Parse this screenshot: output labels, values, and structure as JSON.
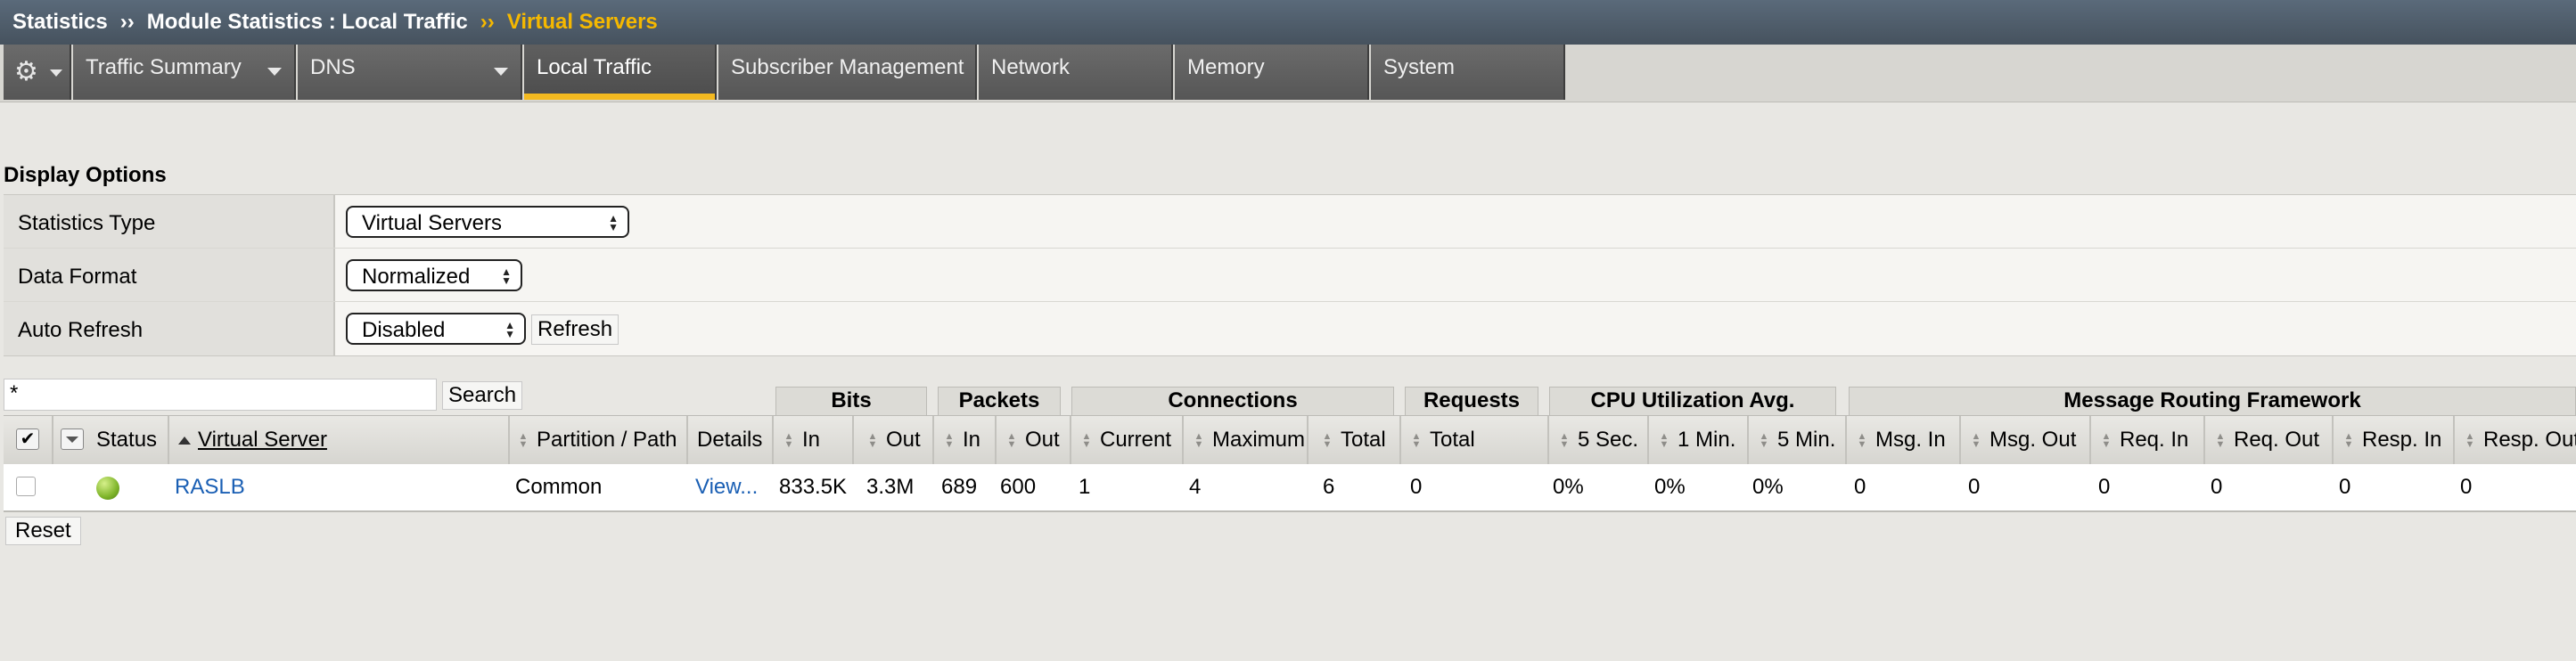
{
  "breadcrumb": {
    "root": "Statistics",
    "sep1": "››",
    "parent": "Module Statistics : Local Traffic",
    "sep2": "››",
    "current": "Virtual Servers"
  },
  "tabs": [
    {
      "label": "Traffic Summary",
      "has_menu": true
    },
    {
      "label": "DNS",
      "has_menu": true
    },
    {
      "label": "Local Traffic",
      "active": true
    },
    {
      "label": "Subscriber Management"
    },
    {
      "label": "Network"
    },
    {
      "label": "Memory"
    },
    {
      "label": "System"
    }
  ],
  "display_options": {
    "title": "Display Options",
    "statistics_type": {
      "label": "Statistics Type",
      "value": "Virtual Servers"
    },
    "data_format": {
      "label": "Data Format",
      "value": "Normalized"
    },
    "auto_refresh": {
      "label": "Auto Refresh",
      "value": "Disabled",
      "button": "Refresh"
    }
  },
  "filter": {
    "value": "*",
    "button": "Search"
  },
  "groups": {
    "bits": "Bits",
    "packets": "Packets",
    "connections": "Connections",
    "requests": "Requests",
    "cpu": "CPU Utilization Avg.",
    "mrf": "Message Routing Framework"
  },
  "columns": {
    "status": "Status",
    "virtual_server": "Virtual Server",
    "partition": "Partition / Path",
    "details": "Details",
    "bits_in": "In",
    "bits_out": "Out",
    "pkts_in": "In",
    "pkts_out": "Out",
    "conn_current": "Current",
    "conn_max": "Maximum",
    "conn_total": "Total",
    "req_total": "Total",
    "cpu_5s": "5 Sec.",
    "cpu_1m": "1 Min.",
    "cpu_5m": "5 Min.",
    "msg_in": "Msg. In",
    "msg_out": "Msg. Out",
    "req_in": "Req. In",
    "req_out": "Req. Out",
    "resp_in": "Resp. In",
    "resp_out": "Resp. Out"
  },
  "row": {
    "name": "RASLB",
    "partition": "Common",
    "details": "View...",
    "bits_in": "833.5K",
    "bits_out": "3.3M",
    "pkts_in": "689",
    "pkts_out": "600",
    "conn_current": "1",
    "conn_max": "4",
    "conn_total": "6",
    "req_total": "0",
    "cpu_5s": "0%",
    "cpu_1m": "0%",
    "cpu_5m": "0%",
    "msg_in": "0",
    "msg_out": "0",
    "req_in": "0",
    "req_out": "0",
    "resp_in": "0",
    "resp_out": "0"
  },
  "reset_button": "Reset",
  "colors": {
    "accent": "#f3b920",
    "link": "#1a5fb4",
    "status_ok": "#7fb52a"
  }
}
